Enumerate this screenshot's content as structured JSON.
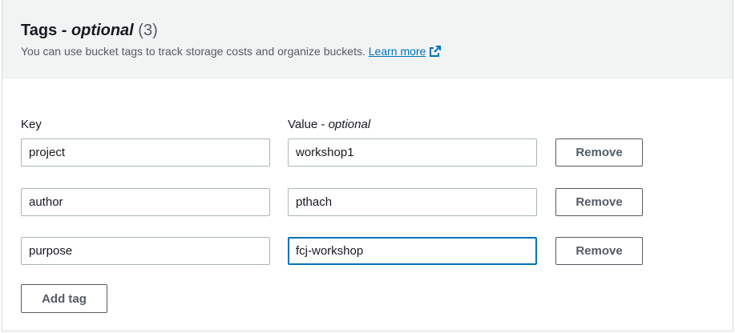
{
  "section": {
    "title_main": "Tags - ",
    "title_optional": "optional",
    "count": "(3)",
    "description": "You can use bucket tags to track storage costs and organize buckets.",
    "learn_more": "Learn more"
  },
  "columns": {
    "key_label": "Key",
    "value_label": "Value - ",
    "value_optional": "optional"
  },
  "tags": [
    {
      "key": "project",
      "value": "workshop1",
      "remove_label": "Remove"
    },
    {
      "key": "author",
      "value": "pthach",
      "remove_label": "Remove"
    },
    {
      "key": "purpose",
      "value": "fcj-workshop",
      "remove_label": "Remove"
    }
  ],
  "add_tag_label": "Add tag",
  "colors": {
    "link": "#0073bb",
    "focus": "#0073bb",
    "header_bg": "#f2f3f3"
  },
  "icons": {
    "learn_more": "external-link-icon"
  }
}
